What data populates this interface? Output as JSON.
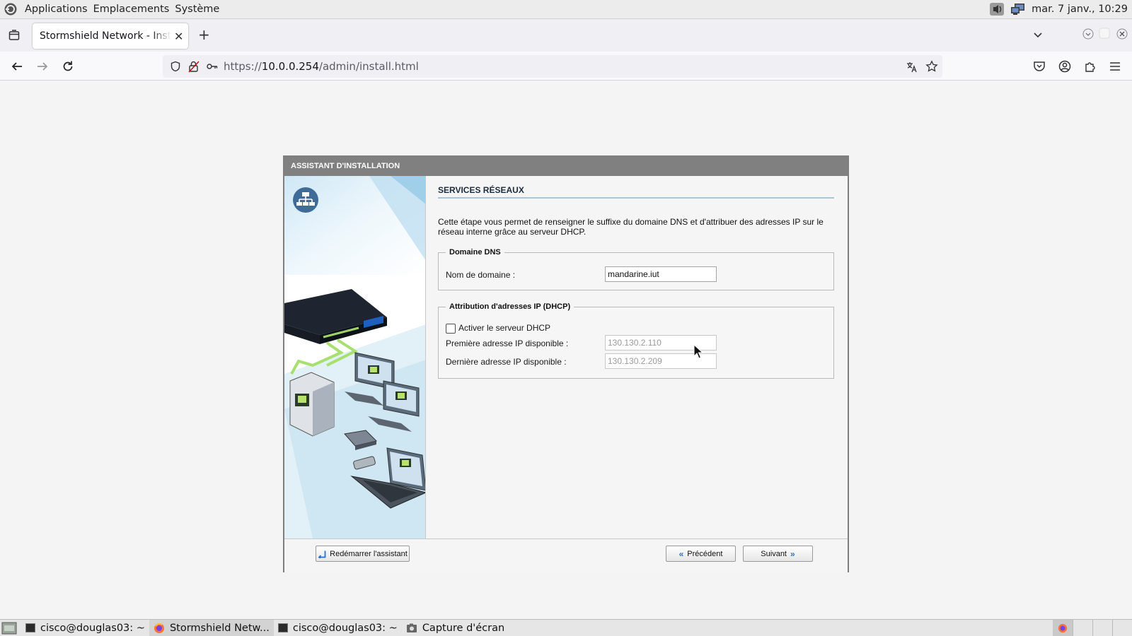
{
  "system_panel": {
    "menus": [
      "Applications",
      "Emplacements",
      "Système"
    ],
    "clock": "mar. 7 janv., 10:29"
  },
  "browser": {
    "tab_title": "Stormshield Network - Installation",
    "url_prefix": "https://",
    "url_host": "10.0.0.254",
    "url_path": "/admin/install.html"
  },
  "wizard": {
    "header": "ASSISTANT D'INSTALLATION",
    "step_title": "SERVICES RÉSEAUX",
    "description": "Cette étape vous permet de renseigner le suffixe du domaine DNS et d'attribuer des adresses IP sur le réseau interne grâce au serveur DHCP.",
    "dns": {
      "legend": "Domaine DNS",
      "domain_label": "Nom de domaine :",
      "domain_value": "mandarine.iut"
    },
    "dhcp": {
      "legend": "Attribution d'adresses IP (DHCP)",
      "enable_label": "Activer le serveur DHCP",
      "enabled": false,
      "first_ip_label": "Première adresse IP disponible :",
      "first_ip_value": "130.130.2.110",
      "last_ip_label": "Dernière adresse IP disponible :",
      "last_ip_value": "130.130.2.209"
    },
    "buttons": {
      "restart": "Redémarrer l'assistant",
      "previous": "Précédent",
      "next": "Suivant"
    }
  },
  "taskbar": {
    "items": [
      "cisco@douglas03: ~",
      "Stormshield Netw...",
      "cisco@douglas03: ~",
      "Capture d'écran"
    ]
  }
}
